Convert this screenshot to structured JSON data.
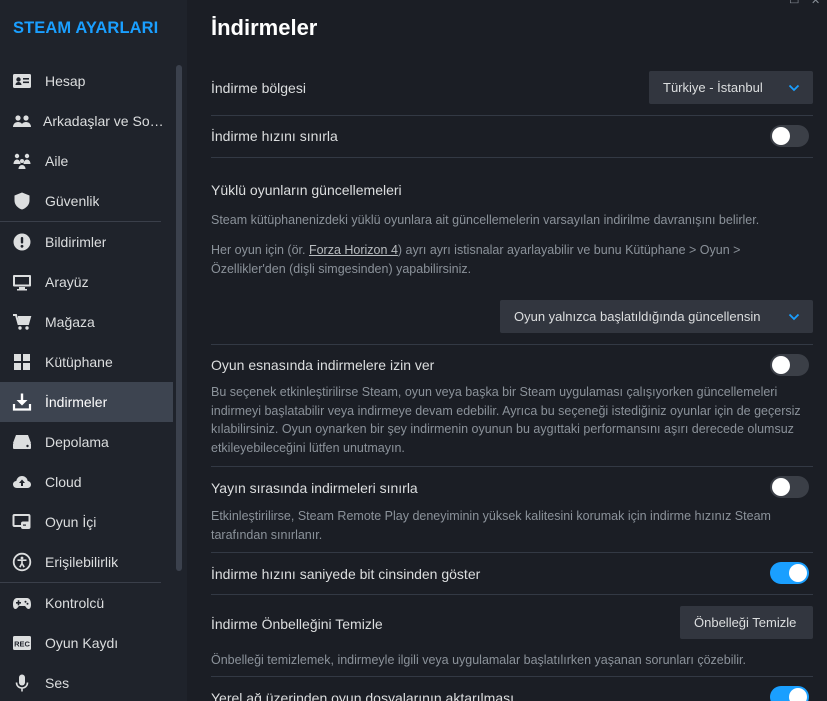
{
  "sidebar": {
    "title": "STEAM AYARLARI",
    "items": [
      {
        "label": "Hesap",
        "icon": "account-card-icon"
      },
      {
        "label": "Arkadaşlar ve Sohbet",
        "icon": "friends-icon"
      },
      {
        "label": "Aile",
        "icon": "family-icon"
      },
      {
        "label": "Güvenlik",
        "icon": "shield-icon"
      },
      {
        "label": "Bildirimler",
        "icon": "alert-icon"
      },
      {
        "label": "Arayüz",
        "icon": "monitor-icon"
      },
      {
        "label": "Mağaza",
        "icon": "cart-icon"
      },
      {
        "label": "Kütüphane",
        "icon": "grid-icon"
      },
      {
        "label": "İndirmeler",
        "icon": "download-icon",
        "active": true
      },
      {
        "label": "Depolama",
        "icon": "drive-icon"
      },
      {
        "label": "Cloud",
        "icon": "cloud-icon"
      },
      {
        "label": "Oyun İçi",
        "icon": "in-game-icon"
      },
      {
        "label": "Erişilebilirlik",
        "icon": "accessibility-icon"
      },
      {
        "label": "Kontrolcü",
        "icon": "gamepad-icon"
      },
      {
        "label": "Oyun Kaydı",
        "icon": "rec-icon"
      },
      {
        "label": "Ses",
        "icon": "microphone-icon"
      }
    ],
    "rec_badge": "REC"
  },
  "main": {
    "title": "İndirmeler",
    "download_region": {
      "label": "İndirme bölgesi",
      "value": "Türkiye - İstanbul"
    },
    "limit_speed": {
      "label": "İndirme hızını sınırla",
      "on": false
    },
    "updates": {
      "heading": "Yüklü oyunların güncellemeleri",
      "desc1": "Steam kütüphanenizdeki yüklü oyunlara ait güncellemelerin varsayılan indirilme davranışını belirler.",
      "desc2_pre": "Her oyun için (ör. ",
      "desc2_link": "Forza Horizon 4",
      "desc2_post": ") ayrı ayrı istisnalar ayarlayabilir ve bunu Kütüphane > Oyun > Özellikler'den (dişli simgesinden) yapabilirsiniz.",
      "dropdown_value": "Oyun yalnızca başlatıldığında güncellensin"
    },
    "allow_during_gameplay": {
      "label": "Oyun esnasında indirmelere izin ver",
      "on": false,
      "desc": "Bu seçenek etkinleştirilirse Steam, oyun veya başka bir Steam uygulaması çalışıyorken güncellemeleri indirmeyi başlatabilir veya indirmeye devam edebilir. Ayrıca bu seçeneği istediğiniz oyunlar için de geçersiz kılabilirsiniz. Oyun oynarken bir şey indirmenin oyunun bu aygıttaki performansını aşırı derecede olumsuz etkileyebileceğini lütfen unutmayın."
    },
    "throttle_streaming": {
      "label": "Yayın sırasında indirmeleri sınırla",
      "on": false,
      "desc": "Etkinleştirilirse, Steam Remote Play deneyiminin yüksek kalitesini korumak için indirme hızınız Steam tarafından sınırlanır."
    },
    "bits_per_second": {
      "label": "İndirme hızını saniyede bit cinsinden göster",
      "on": true
    },
    "clear_cache": {
      "label": "İndirme Önbelleğini Temizle",
      "button": "Önbelleği Temizle",
      "desc": "Önbelleği temizlemek, indirmeyle ilgili veya uygulamalar başlatılırken yaşanan sorunları çözebilir."
    },
    "lan_transfer": {
      "label": "Yerel ağ üzerinden oyun dosyalarının aktarılması",
      "on": true
    }
  },
  "colors": {
    "accent": "#1a9fff",
    "bg": "#1b1e25",
    "sidebar_bg": "#1f232b",
    "active_item": "#3d4450"
  }
}
